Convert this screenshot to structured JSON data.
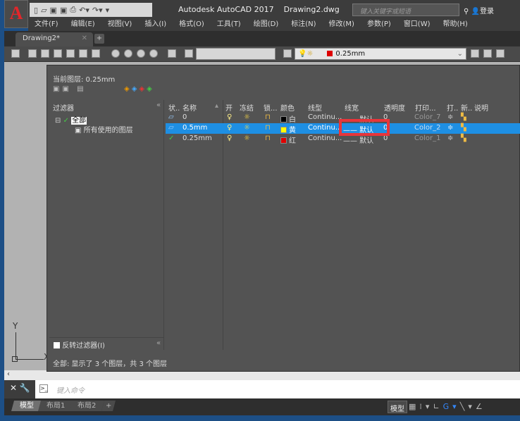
{
  "app": {
    "title": "Autodesk AutoCAD 2017",
    "file": "Drawing2.dwg",
    "search_placeholder": "键入关键字或短语",
    "login": "登录",
    "logo": "A"
  },
  "menu": [
    "文件(F)",
    "编辑(E)",
    "视图(V)",
    "插入(I)",
    "格式(O)",
    "工具(T)",
    "绘图(D)",
    "标注(N)",
    "修改(M)",
    "参数(P)",
    "窗口(W)",
    "帮助(H)"
  ],
  "tabs": {
    "doc": "Drawing2*",
    "close": "✕",
    "add": "+"
  },
  "toolbar": {
    "layer_value": "0.25mm"
  },
  "layer_manager": {
    "current_layer": "当前图层: 0.25mm",
    "filters_title": "过滤器",
    "filter_tree": [
      "全部",
      "所有使用的图层"
    ],
    "invert_filter": "反转过滤器(I)",
    "collapse": "«",
    "columns": [
      "状..",
      "名称",
      "开",
      "冻结",
      "锁...",
      "颜色",
      "线型",
      "线宽",
      "透明度",
      "打印...",
      "打..",
      "新..",
      "说明"
    ],
    "rows": [
      {
        "status": "▱",
        "name": "0",
        "color_name": "白",
        "color": "#000000",
        "linetype": "Continu...",
        "lineweight": "—— 默认",
        "transparency": "0",
        "plot_style": "Color_7",
        "selected": false
      },
      {
        "status": "▱",
        "name": "0.5mm",
        "color_name": "黄",
        "color": "#ffff00",
        "linetype": "Continu...",
        "lineweight": "—— 默认",
        "transparency": "0",
        "plot_style": "Color_2",
        "selected": true
      },
      {
        "status": "✓",
        "name": "0.25mm",
        "color_name": "红",
        "color": "#e00000",
        "linetype": "Continu...",
        "lineweight": "—— 默认",
        "transparency": "0",
        "plot_style": "Color_1",
        "selected": false
      }
    ],
    "summary": "全部: 显示了 3 个图层，共 3 个图层"
  },
  "ucs": {
    "y": "Y",
    "x": "X"
  },
  "command": {
    "placeholder": "键入命令"
  },
  "layout_tabs": [
    "模型",
    "布局1",
    "布局2",
    "+"
  ],
  "status": {
    "model": "模型"
  }
}
